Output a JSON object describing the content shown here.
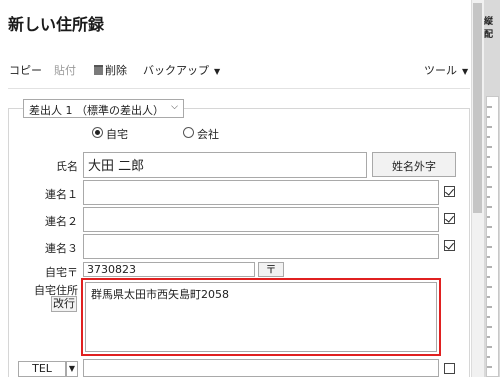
{
  "window": {
    "title": "新しい住所録"
  },
  "toolbar": {
    "copy": "コピー",
    "paste": "貼付",
    "delete": "削除",
    "backup": "バックアップ",
    "tools": "ツール"
  },
  "sender": {
    "selected": "差出人 1 （標準の差出人）",
    "radio_home": "自宅",
    "radio_company": "会社",
    "radio_selected": "自宅"
  },
  "form": {
    "name_label": "氏名",
    "name_value": "大田 二郎",
    "gaiji_button": "姓名外字",
    "renmei1_label": "連名１",
    "renmei2_label": "連名２",
    "renmei3_label": "連名３",
    "renmei_checked": [
      true,
      true,
      true
    ],
    "zip_label": "自宅〒",
    "zip_value": "3730823",
    "zip_button": "〒",
    "address_label": "自宅住所",
    "address_value": "群馬県太田市西矢島町2058",
    "newline_button": "改行",
    "tel_type": "TEL",
    "tel_checked": false
  },
  "side_panel": {
    "label": "縦配"
  },
  "colors": {
    "highlight": "#e02020",
    "field_border": "#a9a9a9"
  }
}
